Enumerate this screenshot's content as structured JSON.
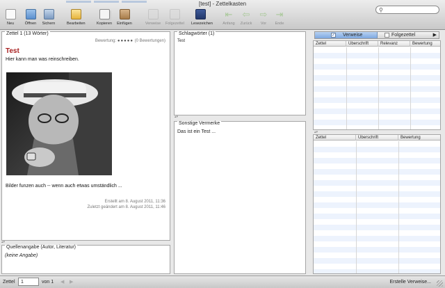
{
  "window": {
    "title": "[test] - Zettelkasten"
  },
  "toolbar": {
    "new": "Neu",
    "open": "Öffnen",
    "save": "Sichern",
    "edit": "Bearbeiten",
    "copy": "Kopieren",
    "paste": "Einfügen",
    "links": "Verweise",
    "followups": "Folgezettel",
    "bookmarks": "Lesezeichen",
    "first": "Anfang",
    "back": "Zurück",
    "forward": "Vor",
    "last": "Ende"
  },
  "search": {
    "placeholder": ""
  },
  "zettel": {
    "header": "Zettel 1 (13 Wörter)",
    "rating_label": "Bewertung:",
    "rating_stars": "●●●●●",
    "rating_count": "(0 Bewertungen)",
    "title": "Test",
    "text1": "Hier kann man was reinschreiben.",
    "text2": "Bilder funzen auch -- wenn auch etwas umständlich ...",
    "created": "Erstellt am 8. August 2011, 11:36",
    "modified": "Zuletzt geändert am 8. August 2011, 11:46"
  },
  "source": {
    "header": "Quellenangabe (Autor, Literatur)",
    "text": "(keine Angabe)"
  },
  "keywords": {
    "header": "Schlagwörter (1)",
    "items": [
      "Test"
    ]
  },
  "remarks": {
    "header": "Sonstige Vermerke",
    "text": "Das ist ein Test ..."
  },
  "right_tabs": {
    "links": "Verweise",
    "followups": "Folgezettel"
  },
  "links_table": {
    "columns": [
      "Zettel",
      "Überschrift",
      "Relevanz",
      "Bewertung"
    ]
  },
  "lower_table": {
    "columns": [
      "Zettel",
      "Überschrift",
      "Bewertung"
    ]
  },
  "statusbar": {
    "zettel_label": "Zettel",
    "zettel_number": "1",
    "of_label": "von 1",
    "prev": "◀",
    "next": "▶",
    "create_links": "Erstelle Verweise..."
  },
  "colors": {
    "title_red": "#a82020",
    "tab_blue": "#7da8e0",
    "row_stripe": "#edf3fd"
  }
}
